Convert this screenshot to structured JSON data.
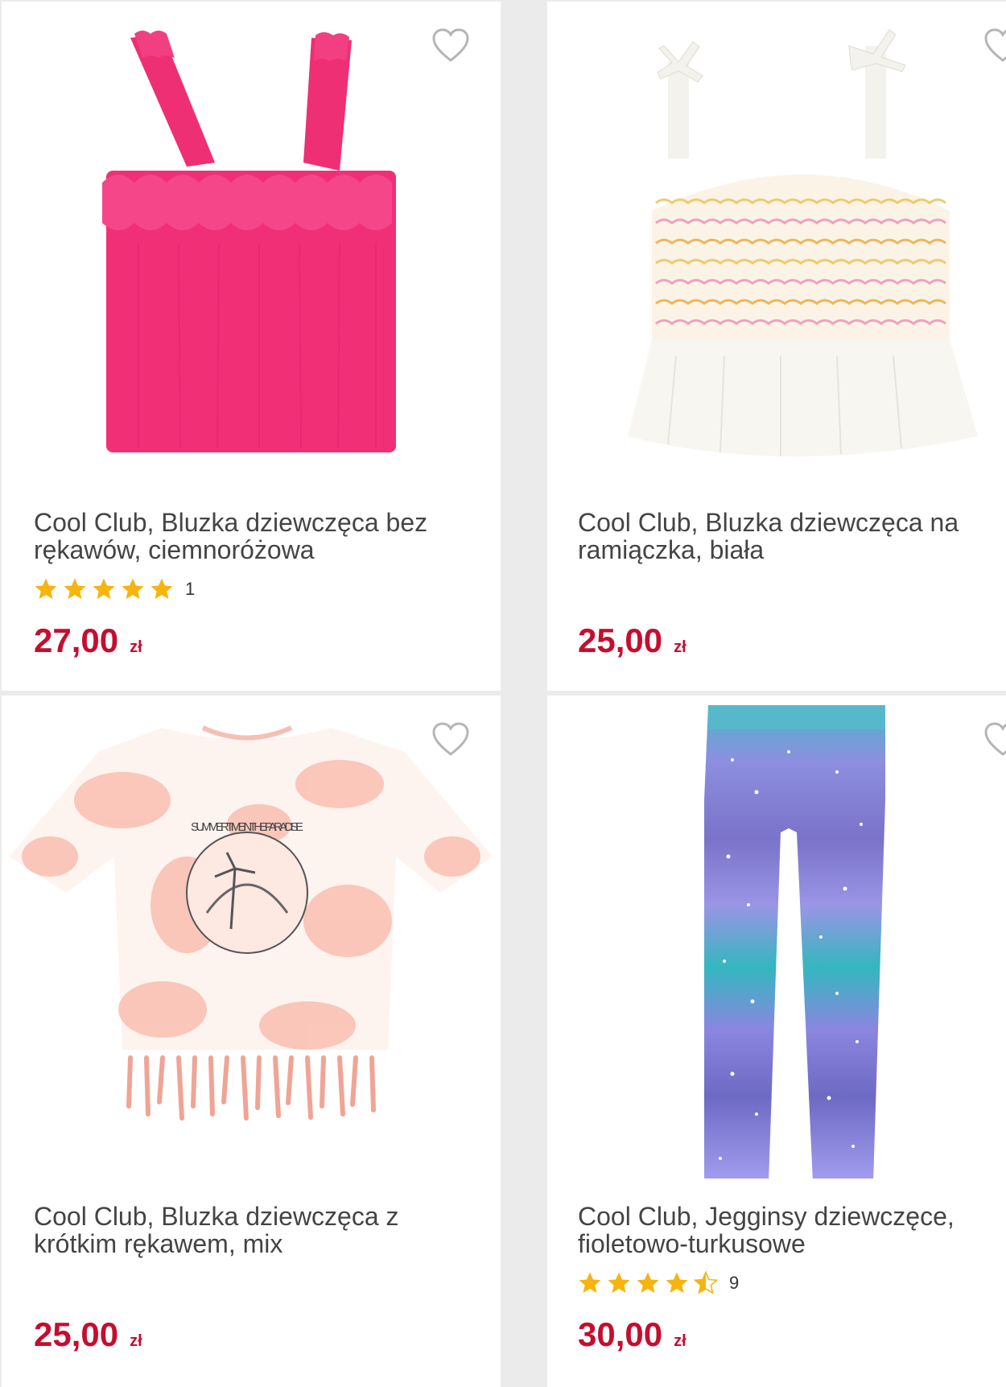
{
  "colors": {
    "price": "#c40e2f",
    "title": "#444444",
    "star": "#f6b40e",
    "background": "#ebebeb"
  },
  "products": [
    {
      "title": "Cool Club, Bluzka dziewczęca bez rękawów, ciemnoróżowa",
      "rating": 5,
      "rating_count": "1",
      "price": "27,00",
      "currency": "zł",
      "image": "pink-ruffle-top"
    },
    {
      "title": "Cool Club, Bluzka dziewczęca na ramiączka, biała",
      "price": "25,00",
      "currency": "zł",
      "image": "white-smocked-top"
    },
    {
      "title": "Cool Club, Bluzka dziewczęca z krótkim rękawem, mix",
      "price": "25,00",
      "currency": "zł",
      "image": "tie-dye-tshirt",
      "print_text": "SUMMER TIME IN THE PARADISE"
    },
    {
      "title": "Cool Club, Jegginsy dziewczęce, fioletowo-turkusowe",
      "rating": 4.5,
      "rating_count": "9",
      "price": "30,00",
      "currency": "zł",
      "image": "galaxy-leggings"
    }
  ],
  "icons": {
    "favorite": "heart-outline-icon",
    "rating": "star-icon"
  }
}
